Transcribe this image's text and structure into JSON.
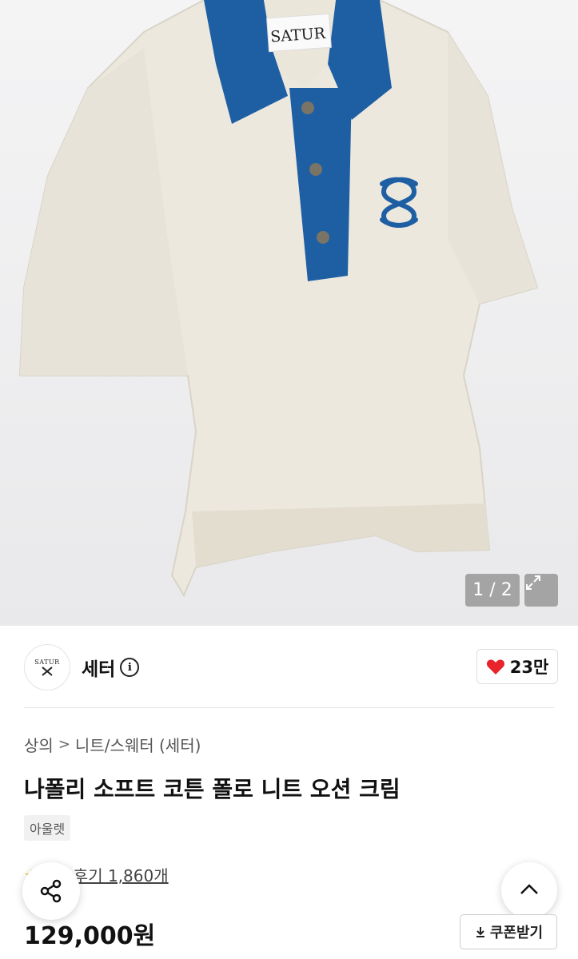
{
  "gallery": {
    "counter": "1 / 2",
    "tag_text": "SATUR",
    "expand_icon": "expand-icon"
  },
  "brand": {
    "logo_text": "SATUR",
    "name": "세터",
    "info_symbol": "i",
    "like_count": "23만",
    "heart_color": "#e8232b"
  },
  "breadcrumb": {
    "level1": "상의",
    "separator": ">",
    "level2": "니트/스웨터 (세터)"
  },
  "product": {
    "title": "나폴리 소프트 코튼 폴로 니트 오션 크림",
    "badge": "아울렛",
    "review_link": "후기 1,860개",
    "price": "129,000원"
  },
  "actions": {
    "coupon_label": "쿠폰받기",
    "coupon_icon": "download-icon",
    "share_icon": "share-icon",
    "scroll_top_icon": "chevron-up-icon"
  },
  "colors": {
    "collar_blue": "#1e5fa3",
    "knit_cream": "#ece8de"
  }
}
